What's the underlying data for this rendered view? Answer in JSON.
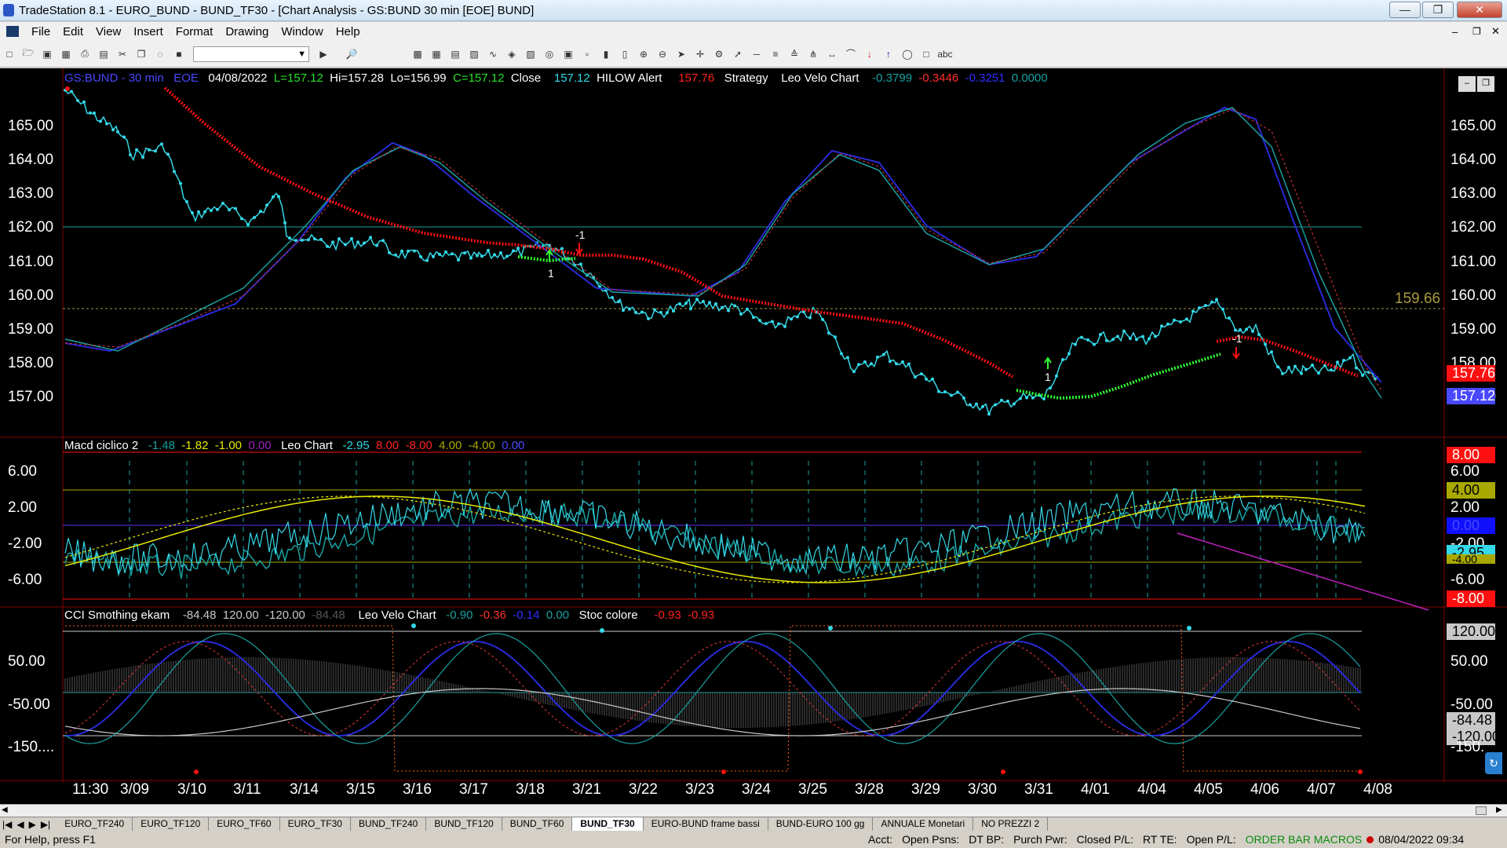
{
  "window": {
    "title": "TradeStation 8.1 - EURO_BUND - BUND_TF30 - [Chart Analysis - GS:BUND  30 min  [EOE] BUND]"
  },
  "menu": [
    "File",
    "Edit",
    "View",
    "Insert",
    "Format",
    "Drawing",
    "Window",
    "Help"
  ],
  "header": {
    "symbol": "GS:BUND - 30 min",
    "feed": "EOE",
    "date": "04/08/2022",
    "last": "L=157.12",
    "hi": "Hi=157.28",
    "lo": "Lo=156.99",
    "close_c": "C=157.12",
    "close_label": "Close",
    "close_val": "157.12",
    "hilow": "HILOW Alert",
    "hilow_val": "157.76",
    "strategy": "Strategy",
    "velo": "Leo Velo Chart",
    "v1": "-0.3799",
    "v2": "-0.3446",
    "v3": "-0.3251",
    "v4": "0.0000"
  },
  "macd_header": {
    "name": "Macd ciclico 2",
    "v1": "-1.48",
    "v2": "-1.82",
    "v3": "-1.00",
    "v4": "0.00",
    "leo": "Leo Chart",
    "l1": "-2.95",
    "l2": "8.00",
    "l3": "-8.00",
    "l4": "4.00",
    "l5": "-4.00",
    "l6": "0.00"
  },
  "cci_header": {
    "name": "CCI Smothing ekam",
    "v1": "-84.48",
    "v2": "120.00",
    "v3": "-120.00",
    "v4": "-84.48",
    "velo": "Leo Velo Chart",
    "w1": "-0.90",
    "w2": "-0.36",
    "w3": "-0.14",
    "w4": "0.00",
    "stoc": "Stoc colore",
    "s1": "-0.93",
    "s2": "-0.93"
  },
  "price_axis": [
    "165.00",
    "164.00",
    "163.00",
    "162.00",
    "161.00",
    "160.00",
    "159.00",
    "158.00",
    "157.00"
  ],
  "price_boxes": {
    "level": "159.66",
    "hilow": "157.76",
    "last": "157.12"
  },
  "macd_axis": [
    "6.00",
    "2.00",
    "-2.00",
    "-6.00"
  ],
  "macd_axis_right": [
    "6.00",
    "2.00",
    "-2.00",
    "-6.00"
  ],
  "macd_boxes": [
    "8.00",
    "4.00",
    "0.00",
    "-2.95",
    "-4.00",
    "-8.00"
  ],
  "cci_axis": [
    "50.00",
    "-50.00",
    "-150...."
  ],
  "cci_axis_right": [
    "50.00",
    "-50.00",
    "-150."
  ],
  "cci_boxes": [
    "120.00",
    "-84.48",
    "-120.00"
  ],
  "markers": {
    "m1": "-1",
    "m2": "1",
    "m3": "1",
    "m4": "-1"
  },
  "dates": [
    "11:30",
    "3/09",
    "3/10",
    "3/11",
    "3/14",
    "3/15",
    "3/16",
    "3/17",
    "3/18",
    "3/21",
    "3/22",
    "3/23",
    "3/24",
    "3/25",
    "3/28",
    "3/29",
    "3/30",
    "3/31",
    "4/01",
    "4/04",
    "4/05",
    "4/06",
    "4/07",
    "4/08"
  ],
  "tabs": [
    "EURO_TF240",
    "EURO_TF120",
    "EURO_TF60",
    "EURO_TF30",
    "BUND_TF240",
    "BUND_TF120",
    "BUND_TF60",
    "BUND_TF30",
    "EURO-BUND frame bassi",
    "BUND-EURO 100 gg",
    "ANNUALE Monetari",
    "NO PREZZI 2"
  ],
  "status": {
    "help": "For Help, press F1",
    "acct": "Acct:",
    "open_psns": "Open Psns:",
    "dtbp": "DT BP:",
    "purch": "Purch Pwr:",
    "closed": "Closed P/L:",
    "rtte": "RT TE:",
    "open_pl": "Open P/L:",
    "macros": "ORDER BAR  MACROS",
    "datetime": "08/04/2022 09:34"
  },
  "colors": {
    "price": "#34d8e8",
    "hilow_red": "#ff1010",
    "hilow_green": "#30ff30",
    "blue": "#2a2ad8",
    "teal": "#1aa0a0",
    "yellow": "#e8e800"
  }
}
